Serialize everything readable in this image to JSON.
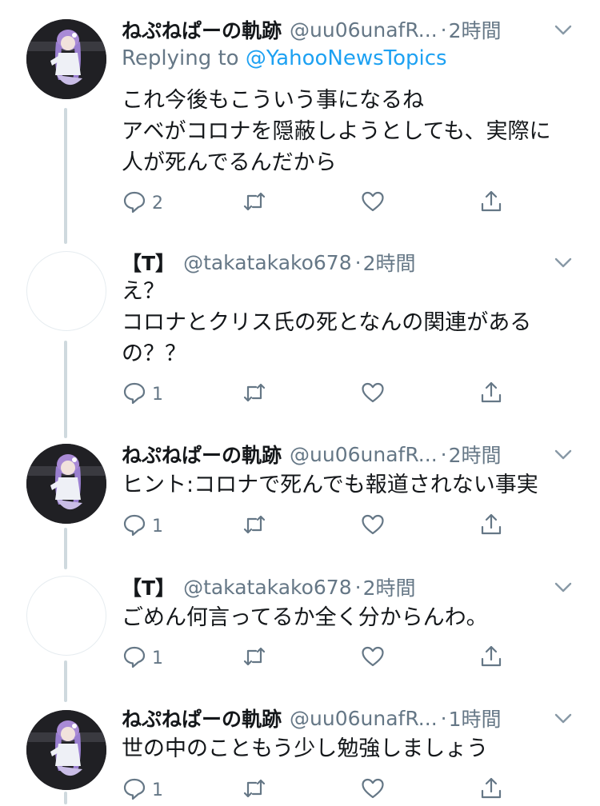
{
  "tweets": [
    {
      "name": "ねぷねぱーの軌跡",
      "handle": "@uu06unafR...",
      "time": "2時間",
      "reply_prefix": "Replying to ",
      "reply_handle": "@YahooNewsTopics",
      "text": "これ今後もこういう事になるね\nアベがコロナを隠蔽しようとしても、実際に\n人が死んでるんだから",
      "reply_count": "2",
      "avatar": "dark"
    },
    {
      "name": "【T】",
      "handle": "@takatakako678",
      "time": "2時間",
      "text": "え？\nコロナとクリス氏の死となんの関連がある\nの？？",
      "reply_count": "1",
      "avatar": "blank"
    },
    {
      "name": "ねぷねぱーの軌跡",
      "handle": "@uu06unafR...",
      "time": "2時間",
      "text": "ヒント:コロナで死んでも報道されない事実",
      "reply_count": "1",
      "avatar": "dark"
    },
    {
      "name": "【T】",
      "handle": "@takatakako678",
      "time": "2時間",
      "text": "ごめん何言ってるか全く分からんわ。",
      "reply_count": "1",
      "avatar": "blank"
    },
    {
      "name": "ねぷねぱーの軌跡",
      "handle": "@uu06unafR...",
      "time": "1時間",
      "text": "世の中のこともう少し勉強しましょう",
      "reply_count": "1",
      "avatar": "dark"
    }
  ],
  "separator": "·",
  "icons": {
    "reply": "reply-icon",
    "retweet": "retweet-icon",
    "like": "heart-icon",
    "share": "share-icon",
    "caret": "chevron-down-icon",
    "avatar": "anime-figure-avatar"
  },
  "colors": {
    "text": "#14171a",
    "muted": "#657786",
    "link": "#1da1f2",
    "thread_line": "#cfd9de"
  }
}
